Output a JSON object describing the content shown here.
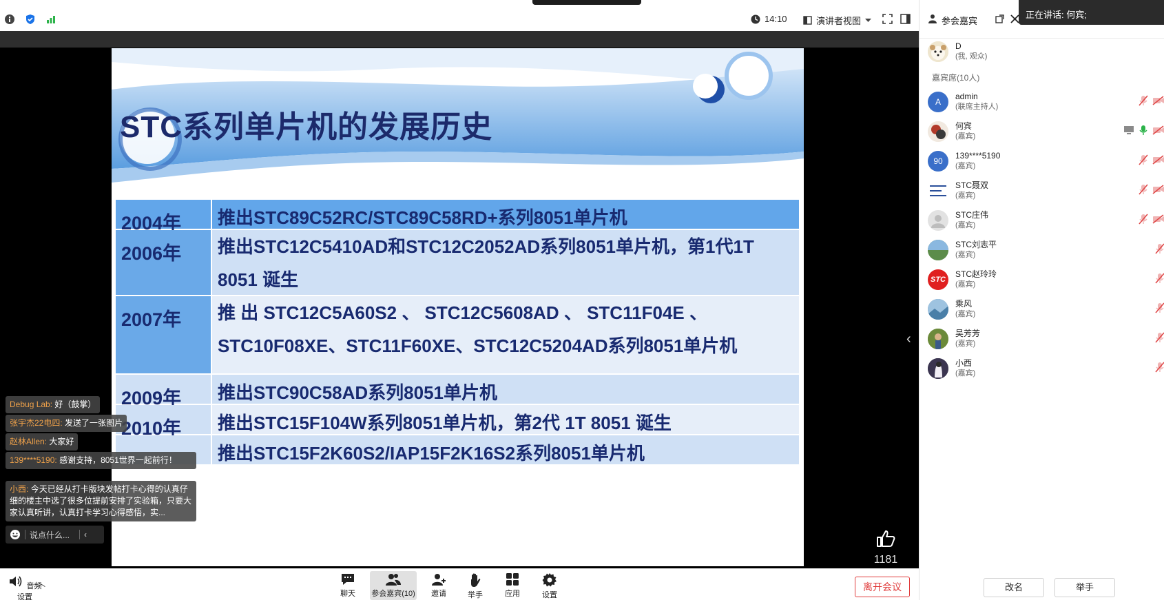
{
  "topbar": {
    "time": "14:10",
    "view_mode": "演讲者视图"
  },
  "slide": {
    "title": "STC系列单片机的发展历史",
    "rows": [
      {
        "year": "2004年",
        "desc": "推出STC89C52RC/STC89C58RD+系列8051单片机"
      },
      {
        "year": "2006年",
        "desc": "推出STC12C5410AD和STC12C2052AD系列8051单片机，第1代1T 8051 诞生"
      },
      {
        "year": "2007年",
        "desc": "推 出 STC12C5A60S2 、 STC12C5608AD 、 STC11F04E 、STC10F08XE、STC11F60XE、STC12C5204AD系列8051单片机"
      },
      {
        "year": "2009年",
        "desc": "推出STC90C58AD系列8051单片机"
      },
      {
        "year": "2010年",
        "desc": "推出STC15F104W系列8051单片机，第2代 1T 8051 诞生"
      },
      {
        "year": "",
        "desc": "推出STC15F2K60S2/IAP15F2K16S2系列8051单片机"
      }
    ]
  },
  "like": {
    "count": "1181"
  },
  "chat": {
    "messages": [
      {
        "who": "Debug Lab:",
        "text": "好（鼓掌）"
      },
      {
        "who": "张宇杰22电四:",
        "text": "发送了一张图片"
      },
      {
        "who": "赵林Allen:",
        "text": "大家好"
      },
      {
        "who": "139****5190:",
        "text": "感谢支持，8051世界一起前行！"
      },
      {
        "who": "小西:",
        "text": "今天已经从打卡版块发帖打卡心得的认真仔细的楼主中选了很多位提前安排了实验箱，只要大家认真听讲，认真打卡学习心得感悟，实..."
      }
    ],
    "input_placeholder": "说点什么..."
  },
  "toolbar": {
    "audio_label": "音频设置",
    "chat_label": "聊天",
    "participants_label": "参会嘉宾(10)",
    "invite_label": "邀请",
    "raise_label": "举手",
    "apps_label": "应用",
    "settings_label": "设置",
    "leave_label": "离开会议"
  },
  "panel": {
    "title": "参会嘉宾",
    "speaking_prefix": "正在讲话:",
    "speaking_name": "何宾;",
    "me": {
      "name": "D",
      "role": "(我, 观众)"
    },
    "section_label": "嘉宾席(10人)",
    "participants": [
      {
        "name": "admin",
        "role": "(联席主持人)",
        "avatar": "A",
        "color": "#3a6fc9"
      },
      {
        "name": "何宾",
        "role": "(嘉宾)",
        "avatar": "",
        "color": "#b23a2a"
      },
      {
        "name": "139****5190",
        "role": "(嘉宾)",
        "avatar": "90",
        "color": "#3a6fc9"
      },
      {
        "name": "STC聂双",
        "role": "(嘉宾)",
        "avatar": "",
        "color": "#dfe6f0"
      },
      {
        "name": "STC庄伟",
        "role": "(嘉宾)",
        "avatar": "",
        "color": "#d5d5d5"
      },
      {
        "name": "STC刘志平",
        "role": "(嘉宾)",
        "avatar": "",
        "color": "#5c8c4a"
      },
      {
        "name": "STC赵玲玲",
        "role": "(嘉宾)",
        "avatar": "STC",
        "color": "#e02020"
      },
      {
        "name": "乘风",
        "role": "(嘉宾)",
        "avatar": "",
        "color": "#4a7fa8"
      },
      {
        "name": "吴芳芳",
        "role": "(嘉宾)",
        "avatar": "",
        "color": "#6b8a3a"
      },
      {
        "name": "小西",
        "role": "(嘉宾)",
        "avatar": "",
        "color": "#3b3550"
      }
    ],
    "rename_label": "改名",
    "raise_label": "举手"
  }
}
